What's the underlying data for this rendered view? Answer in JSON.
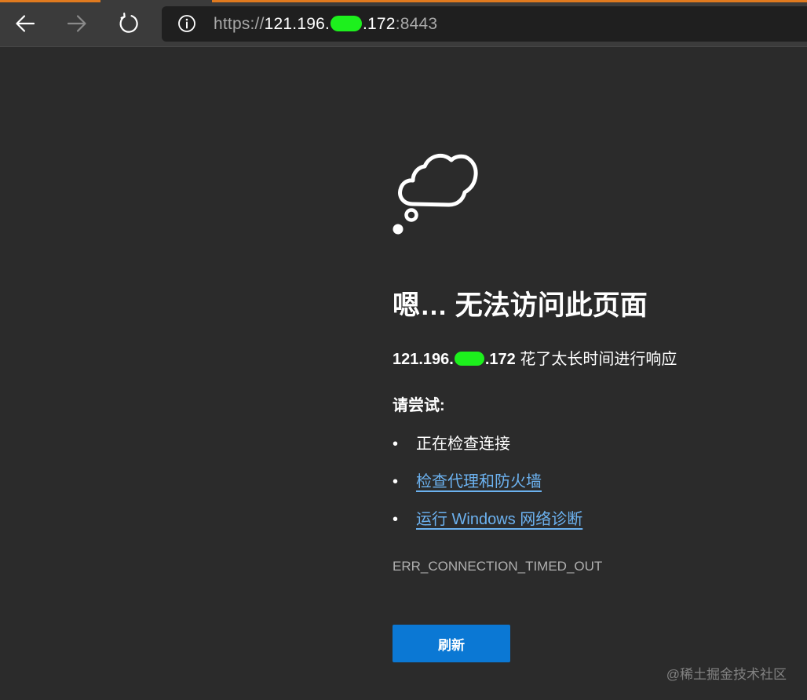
{
  "colors": {
    "accent_top": "#e07a1f",
    "page_bg": "#2b2b2b",
    "link": "#6cb2f0",
    "button_bg": "#0b78d4",
    "redaction": "#1df01d"
  },
  "toolbar": {
    "back_icon": "arrow-left-icon",
    "forward_icon": "arrow-right-icon",
    "refresh_icon": "refresh-icon",
    "info_icon": "info-icon"
  },
  "address": {
    "scheme": "https://",
    "host_start": "121.196.",
    "host_end": ".172",
    "port": ":8443"
  },
  "error": {
    "icon": "thought-cloud-icon",
    "heading": "嗯… 无法访问此页面",
    "ip_start": "121.196.",
    "ip_end": ".172",
    "message": " 花了太长时间进行响应",
    "try_label": "请尝试:",
    "suggestions": [
      "正在检查连接",
      "检查代理和防火墙",
      "运行 Windows 网络诊断"
    ],
    "code": "ERR_CONNECTION_TIMED_OUT",
    "refresh_label": "刷新"
  },
  "watermark": "@稀土掘金技术社区"
}
